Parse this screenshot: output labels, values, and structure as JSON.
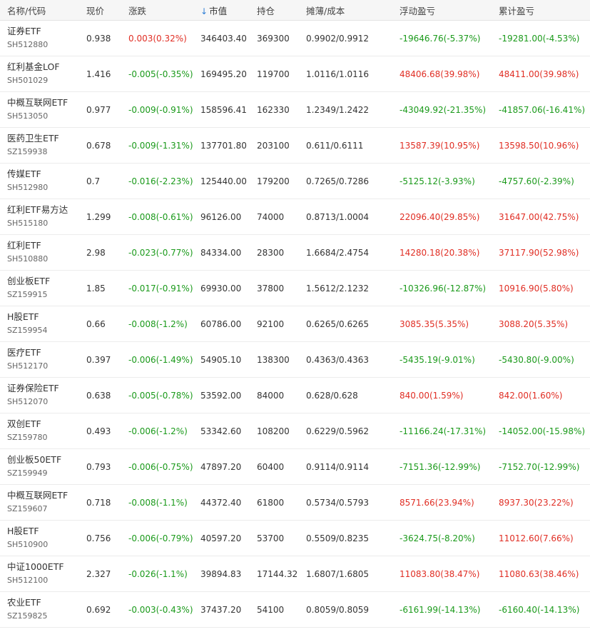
{
  "colors": {
    "up": "#e02e24",
    "down": "#1b9a1b",
    "sort_arrow": "#2f7fd6"
  },
  "columns": [
    {
      "label": "名称/代码"
    },
    {
      "label": "现价"
    },
    {
      "label": "涨跌"
    },
    {
      "label": "市值",
      "sort_icon": "arrow-down-icon"
    },
    {
      "label": "持仓"
    },
    {
      "label": "摊薄/成本"
    },
    {
      "label": "浮动盈亏"
    },
    {
      "label": "累计盈亏"
    }
  ],
  "rows": [
    {
      "name": "证券ETF",
      "code": "SH512880",
      "price": "0.938",
      "change": "0.003(0.32%)",
      "change_dir": "up",
      "value": "346403.40",
      "shares": "369300",
      "cost": "0.9902/0.9912",
      "float_pl": "-19646.76(-5.37%)",
      "float_dir": "down",
      "total_pl": "-19281.00(-4.53%)",
      "total_dir": "down"
    },
    {
      "name": "红利基金LOF",
      "code": "SH501029",
      "price": "1.416",
      "change": "-0.005(-0.35%)",
      "change_dir": "down",
      "value": "169495.20",
      "shares": "119700",
      "cost": "1.0116/1.0116",
      "float_pl": "48406.68(39.98%)",
      "float_dir": "up",
      "total_pl": "48411.00(39.98%)",
      "total_dir": "up"
    },
    {
      "name": "中概互联网ETF",
      "code": "SH513050",
      "price": "0.977",
      "change": "-0.009(-0.91%)",
      "change_dir": "down",
      "value": "158596.41",
      "shares": "162330",
      "cost": "1.2349/1.2422",
      "float_pl": "-43049.92(-21.35%)",
      "float_dir": "down",
      "total_pl": "-41857.06(-16.41%)",
      "total_dir": "down"
    },
    {
      "name": "医药卫生ETF",
      "code": "SZ159938",
      "price": "0.678",
      "change": "-0.009(-1.31%)",
      "change_dir": "down",
      "value": "137701.80",
      "shares": "203100",
      "cost": "0.611/0.6111",
      "float_pl": "13587.39(10.95%)",
      "float_dir": "up",
      "total_pl": "13598.50(10.96%)",
      "total_dir": "up"
    },
    {
      "name": "传媒ETF",
      "code": "SH512980",
      "price": "0.7",
      "change": "-0.016(-2.23%)",
      "change_dir": "down",
      "value": "125440.00",
      "shares": "179200",
      "cost": "0.7265/0.7286",
      "float_pl": "-5125.12(-3.93%)",
      "float_dir": "down",
      "total_pl": "-4757.60(-2.39%)",
      "total_dir": "down"
    },
    {
      "name": "红利ETF易方达",
      "code": "SH515180",
      "price": "1.299",
      "change": "-0.008(-0.61%)",
      "change_dir": "down",
      "value": "96126.00",
      "shares": "74000",
      "cost": "0.8713/1.0004",
      "float_pl": "22096.40(29.85%)",
      "float_dir": "up",
      "total_pl": "31647.00(42.75%)",
      "total_dir": "up"
    },
    {
      "name": "红利ETF",
      "code": "SH510880",
      "price": "2.98",
      "change": "-0.023(-0.77%)",
      "change_dir": "down",
      "value": "84334.00",
      "shares": "28300",
      "cost": "1.6684/2.4754",
      "float_pl": "14280.18(20.38%)",
      "float_dir": "up",
      "total_pl": "37117.90(52.98%)",
      "total_dir": "up"
    },
    {
      "name": "创业板ETF",
      "code": "SZ159915",
      "price": "1.85",
      "change": "-0.017(-0.91%)",
      "change_dir": "down",
      "value": "69930.00",
      "shares": "37800",
      "cost": "1.5612/2.1232",
      "float_pl": "-10326.96(-12.87%)",
      "float_dir": "down",
      "total_pl": "10916.90(5.80%)",
      "total_dir": "up"
    },
    {
      "name": "H股ETF",
      "code": "SZ159954",
      "price": "0.66",
      "change": "-0.008(-1.2%)",
      "change_dir": "down",
      "value": "60786.00",
      "shares": "92100",
      "cost": "0.6265/0.6265",
      "float_pl": "3085.35(5.35%)",
      "float_dir": "up",
      "total_pl": "3088.20(5.35%)",
      "total_dir": "up"
    },
    {
      "name": "医疗ETF",
      "code": "SH512170",
      "price": "0.397",
      "change": "-0.006(-1.49%)",
      "change_dir": "down",
      "value": "54905.10",
      "shares": "138300",
      "cost": "0.4363/0.4363",
      "float_pl": "-5435.19(-9.01%)",
      "float_dir": "down",
      "total_pl": "-5430.80(-9.00%)",
      "total_dir": "down"
    },
    {
      "name": "证券保险ETF",
      "code": "SH512070",
      "price": "0.638",
      "change": "-0.005(-0.78%)",
      "change_dir": "down",
      "value": "53592.00",
      "shares": "84000",
      "cost": "0.628/0.628",
      "float_pl": "840.00(1.59%)",
      "float_dir": "up",
      "total_pl": "842.00(1.60%)",
      "total_dir": "up"
    },
    {
      "name": "双创ETF",
      "code": "SZ159780",
      "price": "0.493",
      "change": "-0.006(-1.2%)",
      "change_dir": "down",
      "value": "53342.60",
      "shares": "108200",
      "cost": "0.6229/0.5962",
      "float_pl": "-11166.24(-17.31%)",
      "float_dir": "down",
      "total_pl": "-14052.00(-15.98%)",
      "total_dir": "down"
    },
    {
      "name": "创业板50ETF",
      "code": "SZ159949",
      "price": "0.793",
      "change": "-0.006(-0.75%)",
      "change_dir": "down",
      "value": "47897.20",
      "shares": "60400",
      "cost": "0.9114/0.9114",
      "float_pl": "-7151.36(-12.99%)",
      "float_dir": "down",
      "total_pl": "-7152.70(-12.99%)",
      "total_dir": "down"
    },
    {
      "name": "中概互联网ETF",
      "code": "SZ159607",
      "price": "0.718",
      "change": "-0.008(-1.1%)",
      "change_dir": "down",
      "value": "44372.40",
      "shares": "61800",
      "cost": "0.5734/0.5793",
      "float_pl": "8571.66(23.94%)",
      "float_dir": "up",
      "total_pl": "8937.30(23.22%)",
      "total_dir": "up"
    },
    {
      "name": "H股ETF",
      "code": "SH510900",
      "price": "0.756",
      "change": "-0.006(-0.79%)",
      "change_dir": "down",
      "value": "40597.20",
      "shares": "53700",
      "cost": "0.5509/0.8235",
      "float_pl": "-3624.75(-8.20%)",
      "float_dir": "down",
      "total_pl": "11012.60(7.66%)",
      "total_dir": "up"
    },
    {
      "name": "中证1000ETF",
      "code": "SH512100",
      "price": "2.327",
      "change": "-0.026(-1.1%)",
      "change_dir": "down",
      "value": "39894.83",
      "shares": "17144.32",
      "cost": "1.6807/1.6805",
      "float_pl": "11083.80(38.47%)",
      "float_dir": "up",
      "total_pl": "11080.63(38.46%)",
      "total_dir": "up"
    },
    {
      "name": "农业ETF",
      "code": "SZ159825",
      "price": "0.692",
      "change": "-0.003(-0.43%)",
      "change_dir": "down",
      "value": "37437.20",
      "shares": "54100",
      "cost": "0.8059/0.8059",
      "float_pl": "-6161.99(-14.13%)",
      "float_dir": "down",
      "total_pl": "-6160.40(-14.13%)",
      "total_dir": "down"
    }
  ]
}
